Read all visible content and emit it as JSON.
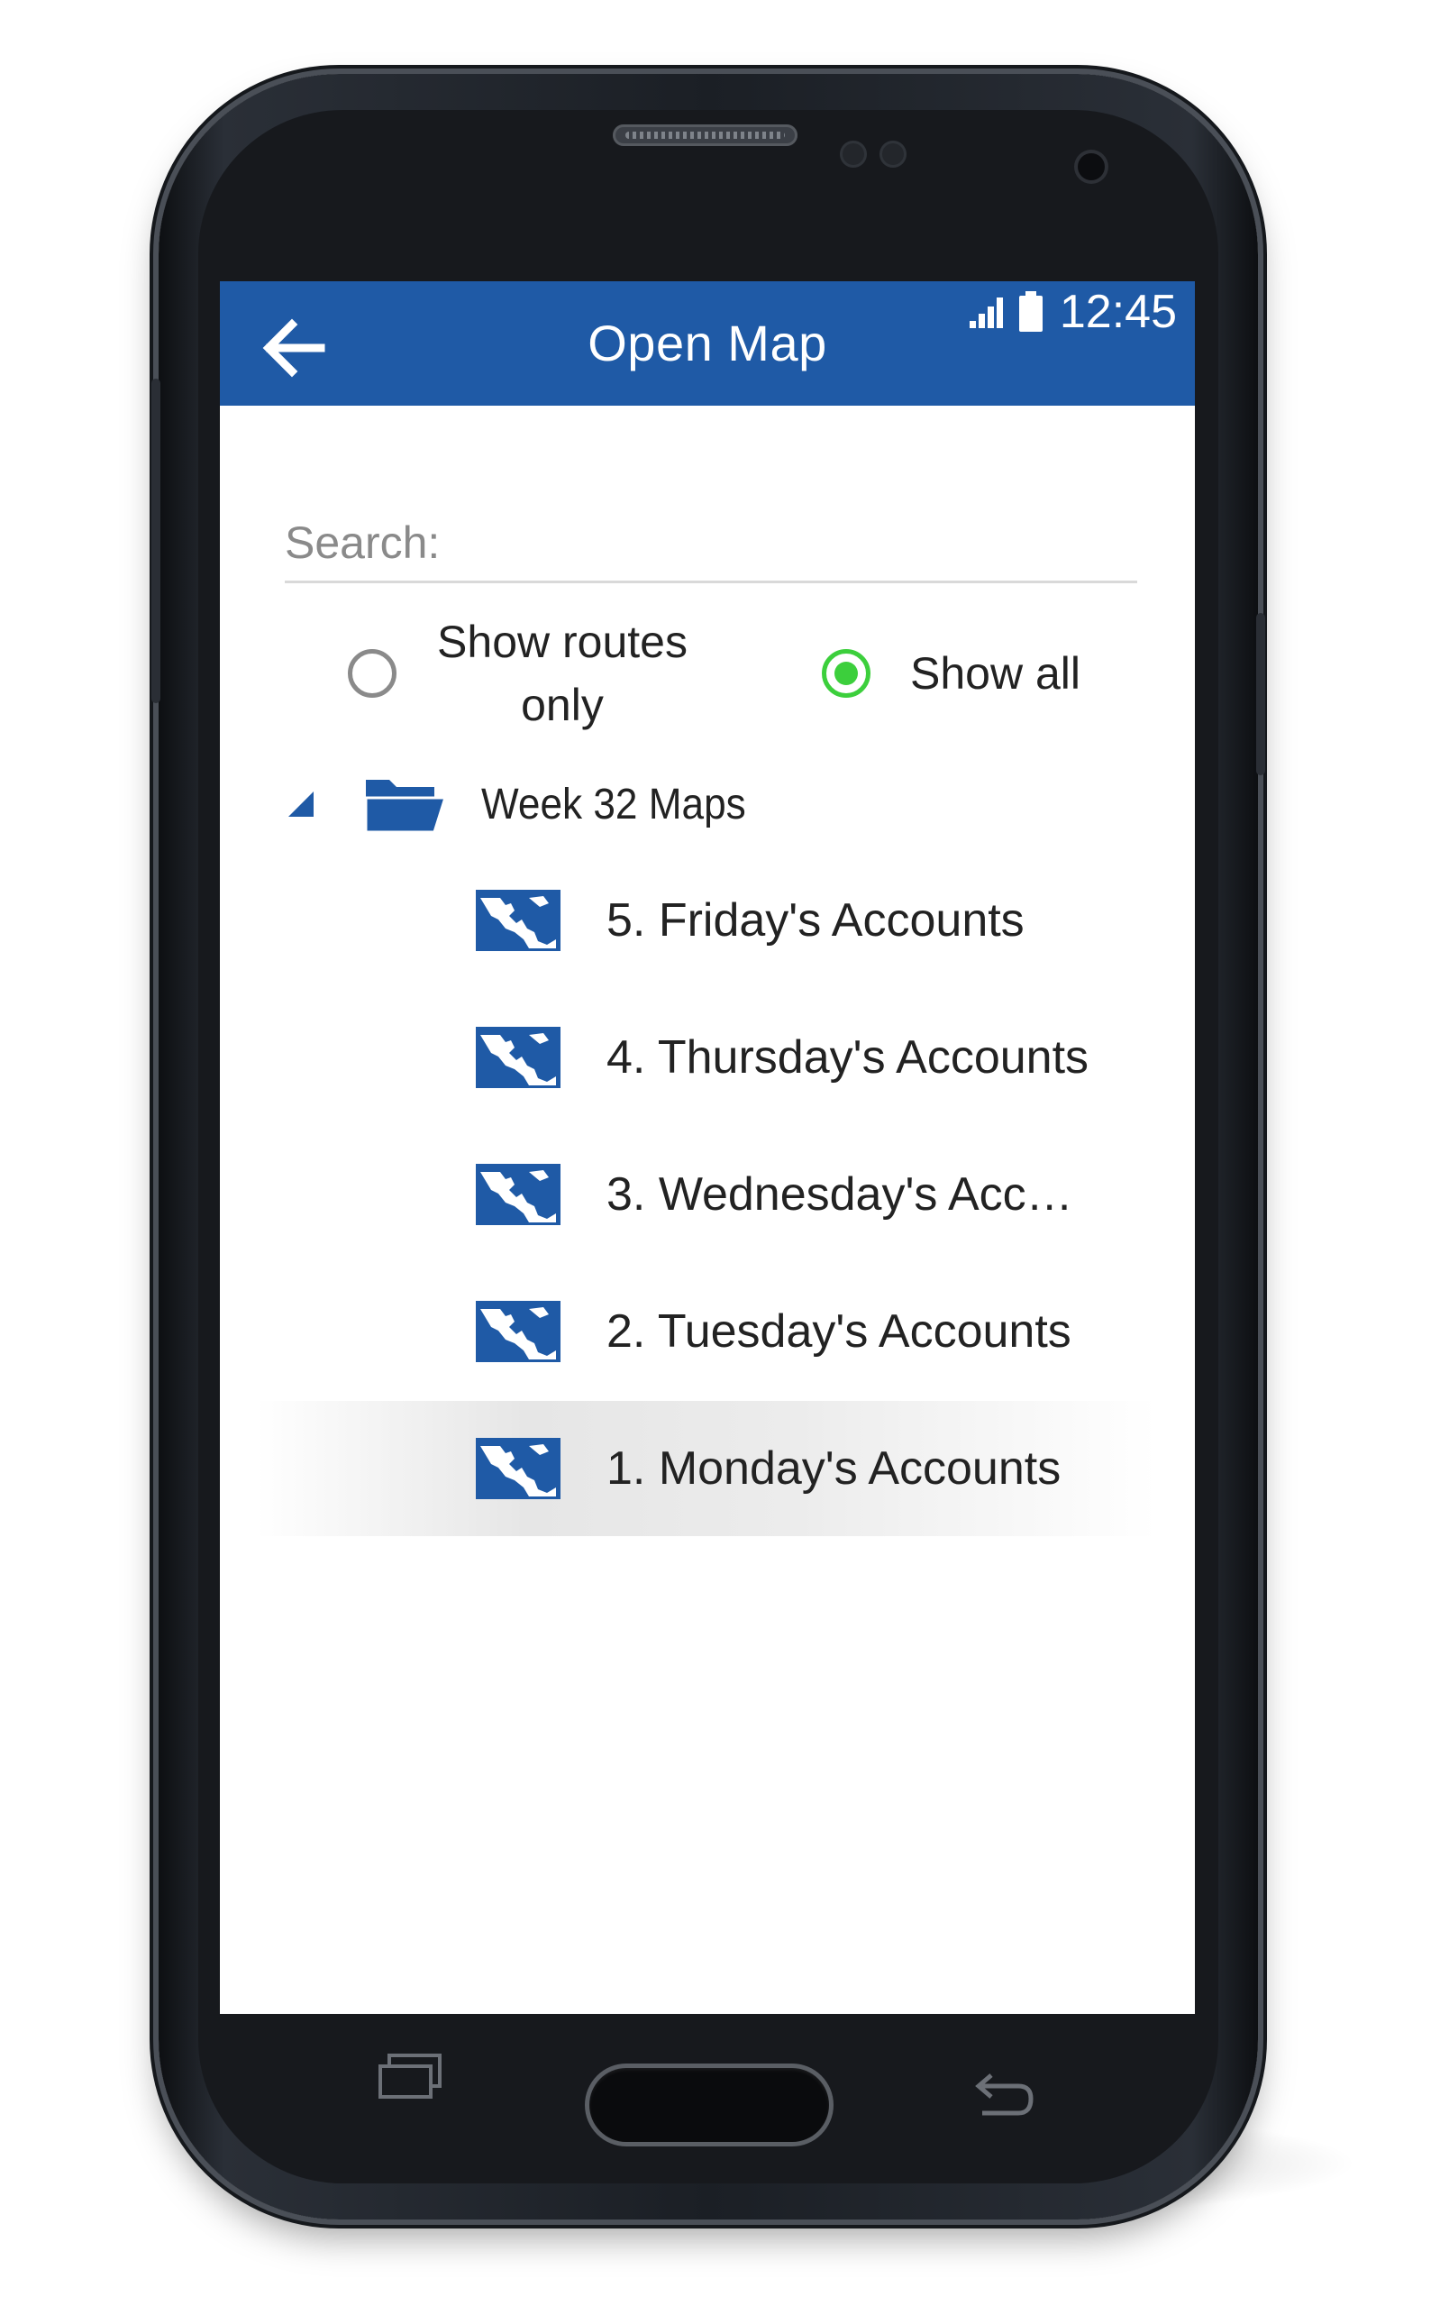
{
  "status_bar": {
    "time": "12:45",
    "icons": [
      "signal-icon",
      "battery-icon"
    ]
  },
  "app_bar": {
    "title": "Open Map",
    "back_icon": "arrow-left-icon"
  },
  "search": {
    "placeholder": "Search:",
    "value": ""
  },
  "filter": {
    "options": [
      {
        "label_line1": "Show routes",
        "label_line2": "only",
        "selected": false
      },
      {
        "label": "Show all",
        "selected": true
      }
    ],
    "selected_color": "#3ccf3c"
  },
  "tree": {
    "folder": {
      "label": "Week 32 Maps",
      "expanded": true,
      "icon": "folder-open-icon"
    },
    "items": [
      {
        "label": "5. Friday's Accounts",
        "icon": "map-icon",
        "selected": false
      },
      {
        "label": "4. Thursday's Accounts",
        "icon": "map-icon",
        "selected": false
      },
      {
        "label": "3. Wednesday's Acco…",
        "icon": "map-icon",
        "selected": false
      },
      {
        "label": "2. Tuesday's Accounts",
        "icon": "map-icon",
        "selected": false
      },
      {
        "label": "1. Monday's Accounts",
        "icon": "map-icon",
        "selected": true
      }
    ]
  },
  "nav": {
    "recent_icon": "recent-apps-icon",
    "home_icon": "home-button",
    "back_icon": "system-back-icon"
  },
  "colors": {
    "brand": "#1f5aa6",
    "icon_blue": "#1f5aa6"
  }
}
